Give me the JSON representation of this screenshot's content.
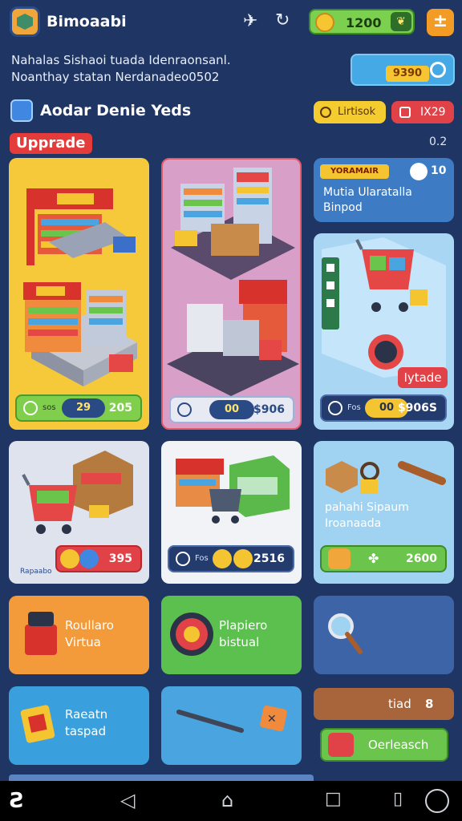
{
  "app": {
    "title": "Bimoaabi",
    "coins": "1200"
  },
  "info": {
    "line1": "Nahalas Sishaoi tuada Idenraonsanl.",
    "line2": "Noanthay statan Nerdanadeo0502",
    "offer_value": "9390"
  },
  "section": {
    "title": "Aodar Denie Yeds",
    "yellow_btn": "Lirtisok",
    "red_btn": "IX29",
    "upgrade_label": "Upprade",
    "version": "0.2"
  },
  "cards": {
    "c1": {
      "label": "sos",
      "mid": "29",
      "value": "205"
    },
    "c2": {
      "mid": "00",
      "value": "$906"
    },
    "c3": {
      "badge": "YORAMAIR",
      "badge_num": "10",
      "title1": "Mutia Ularatalla",
      "title2": "Binpod"
    },
    "c4": {
      "btn": "Iytade",
      "label": "Fos",
      "mid": "00",
      "value": "$906S"
    },
    "c5": {
      "label": "Rapaabo",
      "value": "395"
    },
    "c6": {
      "label": "Fos",
      "value": "2516"
    },
    "c7": {
      "text1": "pahahi Sipaum",
      "text2": "Iroanaada",
      "value": "2600"
    },
    "c8": {
      "text1": "Roullaro",
      "text2": "Virtua"
    },
    "c9": {
      "text1": "Plapiero",
      "text2": "bistual"
    },
    "c11": {
      "text1": "Raeatn",
      "text2": "taspad"
    },
    "c13": {
      "top": "tiad",
      "top_num": "8",
      "btn": "Oerleasch"
    }
  },
  "colors": {
    "background": "#1f3563",
    "yellow": "#f5cc2f",
    "red": "#e04248",
    "green": "#6bc44b"
  }
}
